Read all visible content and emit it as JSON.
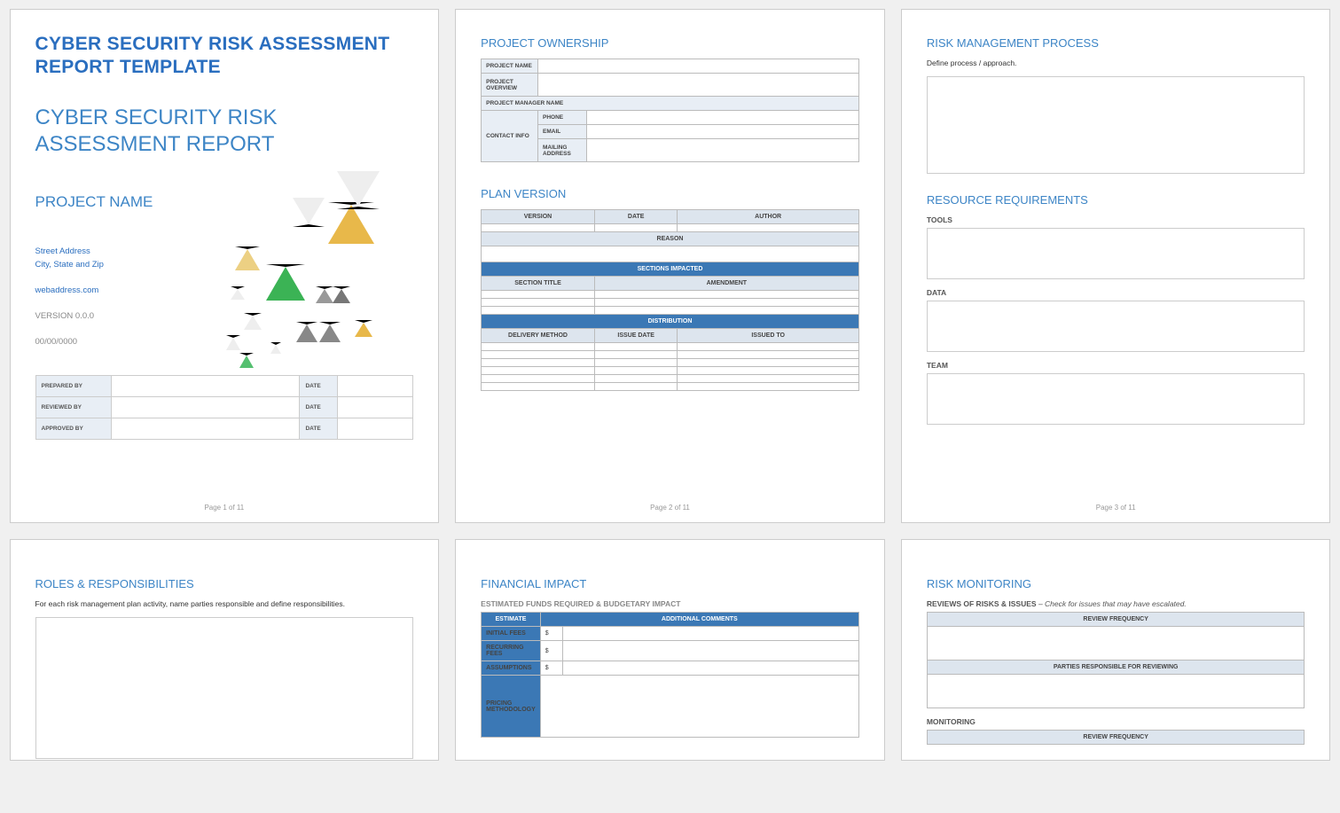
{
  "page1": {
    "template_title": "CYBER SECURITY RISK ASSESSMENT REPORT TEMPLATE",
    "report_title": "CYBER SECURITY RISK ASSESSMENT REPORT",
    "project_name": "PROJECT NAME",
    "street": "Street Address",
    "city": "City, State and Zip",
    "web": "webaddress.com",
    "version": "VERSION 0.0.0",
    "date": "00/00/0000",
    "rows": {
      "prepared": "PREPARED BY",
      "reviewed": "REVIEWED BY",
      "approved": "APPROVED BY",
      "date_label": "DATE"
    },
    "footer": "Page 1 of 11"
  },
  "page2": {
    "ownership": {
      "heading": "PROJECT OWNERSHIP",
      "project_name": "PROJECT NAME",
      "project_overview": "PROJECT OVERVIEW",
      "project_manager": "PROJECT MANAGER NAME",
      "contact_info": "CONTACT INFO",
      "phone": "PHONE",
      "email": "EMAIL",
      "mailing": "MAILING ADDRESS"
    },
    "plan": {
      "heading": "PLAN VERSION",
      "version": "VERSION",
      "date": "DATE",
      "author": "AUTHOR",
      "reason": "REASON",
      "sections_impacted": "SECTIONS IMPACTED",
      "section_title": "SECTION TITLE",
      "amendment": "AMENDMENT",
      "distribution": "DISTRIBUTION",
      "delivery_method": "DELIVERY METHOD",
      "issue_date": "ISSUE DATE",
      "issued_to": "ISSUED TO"
    },
    "footer": "Page 2 of 11"
  },
  "page3": {
    "rmp": {
      "heading": "RISK MANAGEMENT PROCESS",
      "body": "Define process / approach."
    },
    "res": {
      "heading": "RESOURCE REQUIREMENTS",
      "tools": "TOOLS",
      "data": "DATA",
      "team": "TEAM"
    },
    "footer": "Page 3 of 11"
  },
  "page4": {
    "heading": "ROLES & RESPONSIBILITIES",
    "body": "For each risk management plan activity, name parties responsible and define responsibilities."
  },
  "page5": {
    "heading": "FINANCIAL IMPACT",
    "sub": "ESTIMATED FUNDS REQUIRED & BUDGETARY IMPACT",
    "est": "ESTIMATE",
    "comments": "ADDITIONAL COMMENTS",
    "initial": "INITIAL FEES",
    "recurring": "RECURRING FEES",
    "assumptions": "ASSUMPTIONS",
    "pricing": "PRICING METHODOLOGY",
    "dollar": "$"
  },
  "page6": {
    "heading": "RISK MONITORING",
    "reviews_heading": "REVIEWS OF RISKS & ISSUES",
    "reviews_note": " – Check for issues that may have escalated.",
    "review_freq": "REVIEW FREQUENCY",
    "parties": "PARTIES RESPONSIBLE FOR REVIEWING",
    "monitoring": "MONITORING"
  }
}
